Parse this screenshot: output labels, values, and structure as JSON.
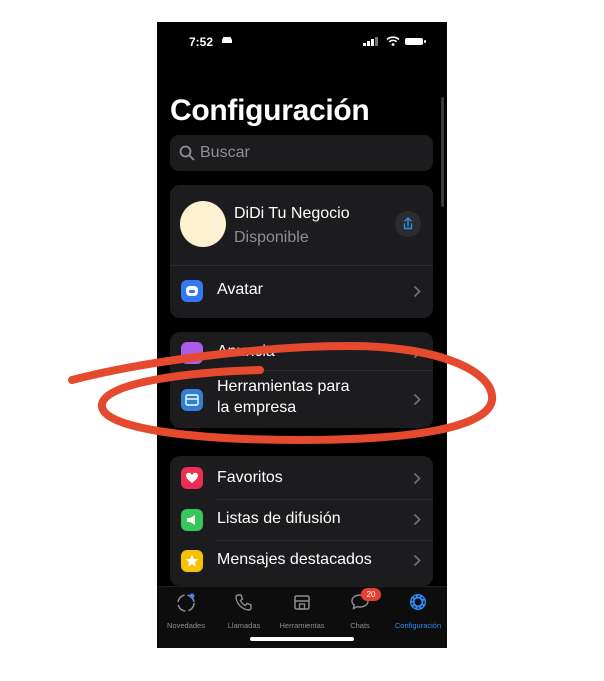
{
  "status_bar": {
    "time": "7:52"
  },
  "header": {
    "title": "Configuración"
  },
  "search": {
    "placeholder": "Buscar"
  },
  "profile": {
    "name": "DiDi Tu Negocio",
    "status": "Disponible"
  },
  "avatar_row": {
    "label": "Avatar",
    "icon_color": "#3478f6"
  },
  "business": {
    "items": [
      {
        "label": "Anuncia",
        "icon_color": "#a95de6"
      },
      {
        "label_line1": "Herramientas para",
        "label_line2": "la empresa",
        "icon_color": "#2f7fd6"
      }
    ]
  },
  "lists": {
    "items": [
      {
        "label": "Favoritos",
        "icon_color": "#ec2e55"
      },
      {
        "label": "Listas de difusión",
        "icon_color": "#35c759"
      },
      {
        "label": "Mensajes destacados",
        "icon_color": "#f6c200"
      }
    ]
  },
  "tabbar": {
    "tabs": [
      {
        "label": "Novedades"
      },
      {
        "label": "Llamadas"
      },
      {
        "label": "Herramientas"
      },
      {
        "label": "Chats",
        "badge": "20"
      },
      {
        "label": "Configuración",
        "active": true
      }
    ]
  },
  "colors": {
    "active_tab": "#2f8cf6",
    "annotation": "#e64a2e",
    "background": "#000000"
  }
}
